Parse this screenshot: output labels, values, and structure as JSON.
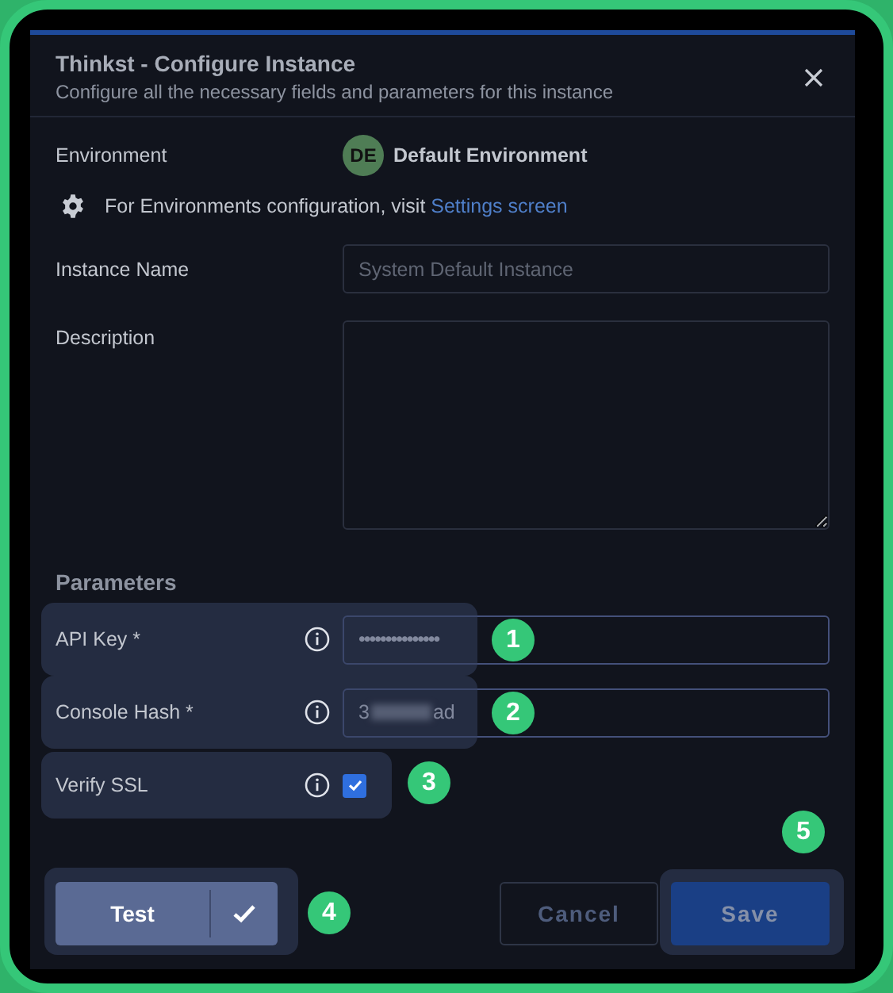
{
  "dialog": {
    "title": "Thinkst - Configure Instance",
    "subtitle": "Configure all the necessary fields and parameters for this instance"
  },
  "environment": {
    "label": "Environment",
    "initials": "DE",
    "color": "#4f7d55",
    "name": "Default Environment"
  },
  "settings_note": {
    "text": "For Environments configuration, visit",
    "link": "Settings screen"
  },
  "instance_name": {
    "label": "Instance Name",
    "placeholder": "System Default Instance"
  },
  "description": {
    "label": "Description"
  },
  "parameters": {
    "heading": "Parameters",
    "items": [
      {
        "kind": "password",
        "label": "API Key *",
        "value": "•••••••••••••••",
        "highlighted": true,
        "callout": "1"
      },
      {
        "kind": "text",
        "label": "Console Hash *",
        "value_start": "3",
        "value_end": "ad",
        "highlighted": true,
        "callout": "2"
      },
      {
        "kind": "checkbox",
        "label": "Verify SSL",
        "checked": true,
        "highlighted": true,
        "callout": "3"
      }
    ]
  },
  "footer": {
    "test": {
      "label": "Test",
      "highlighted": true,
      "callout": "4"
    },
    "cancel": {
      "label": "Cancel"
    },
    "save": {
      "label": "Save",
      "highlighted": true,
      "callout": "5"
    }
  }
}
